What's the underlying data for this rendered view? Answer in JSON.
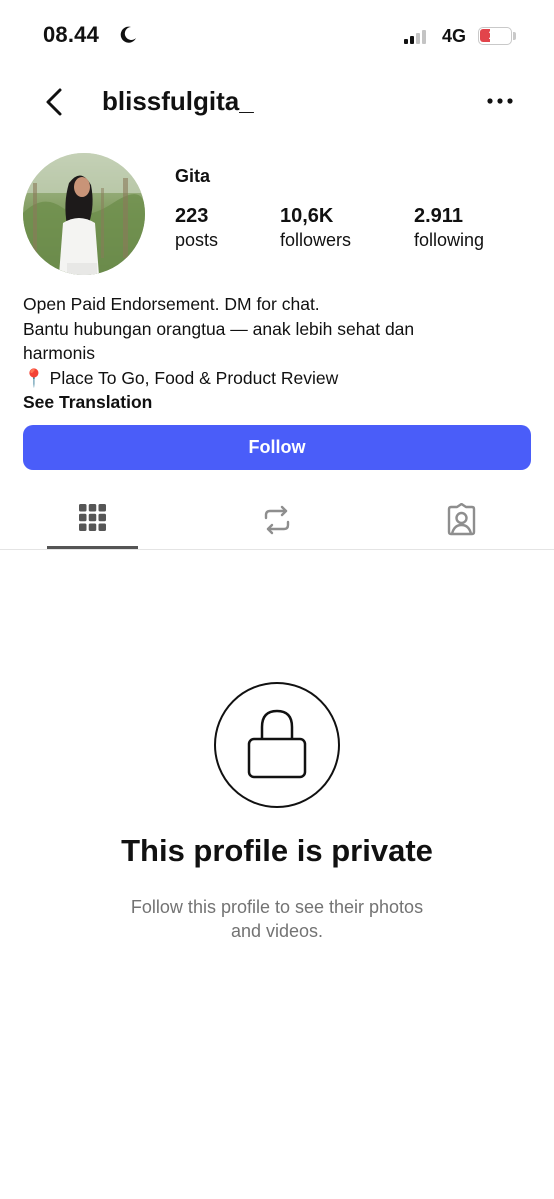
{
  "status_bar": {
    "time": "08.44",
    "network": "4G",
    "battery_level": "16",
    "battery_color": "#e2444b"
  },
  "header": {
    "username": "blissfulgita_",
    "back_icon": "chevron-left-icon",
    "menu_icon": "more-horizontal-icon"
  },
  "profile": {
    "display_name": "Gita",
    "stats": [
      {
        "value": "223",
        "label": "posts"
      },
      {
        "value": "10,6K",
        "label": "followers"
      },
      {
        "value": "2.911",
        "label": "following"
      }
    ],
    "bio_lines": [
      "Open Paid Endorsement. DM for chat.",
      "Bantu hubungan orangtua — anak lebih sehat dan",
      "harmonis",
      "📍 Place To Go, Food & Product Review"
    ],
    "see_translation": "See Translation"
  },
  "follow_button": {
    "label": "Follow",
    "color": "#4a5df9"
  },
  "tabs": [
    {
      "icon": "grid-icon",
      "active": true
    },
    {
      "icon": "reels-repost-icon",
      "active": false
    },
    {
      "icon": "tagged-person-icon",
      "active": false
    }
  ],
  "private_notice": {
    "icon": "lock-icon",
    "title": "This profile is private",
    "subtitle_lines": [
      "Follow this profile to see their photos",
      "and videos."
    ]
  }
}
